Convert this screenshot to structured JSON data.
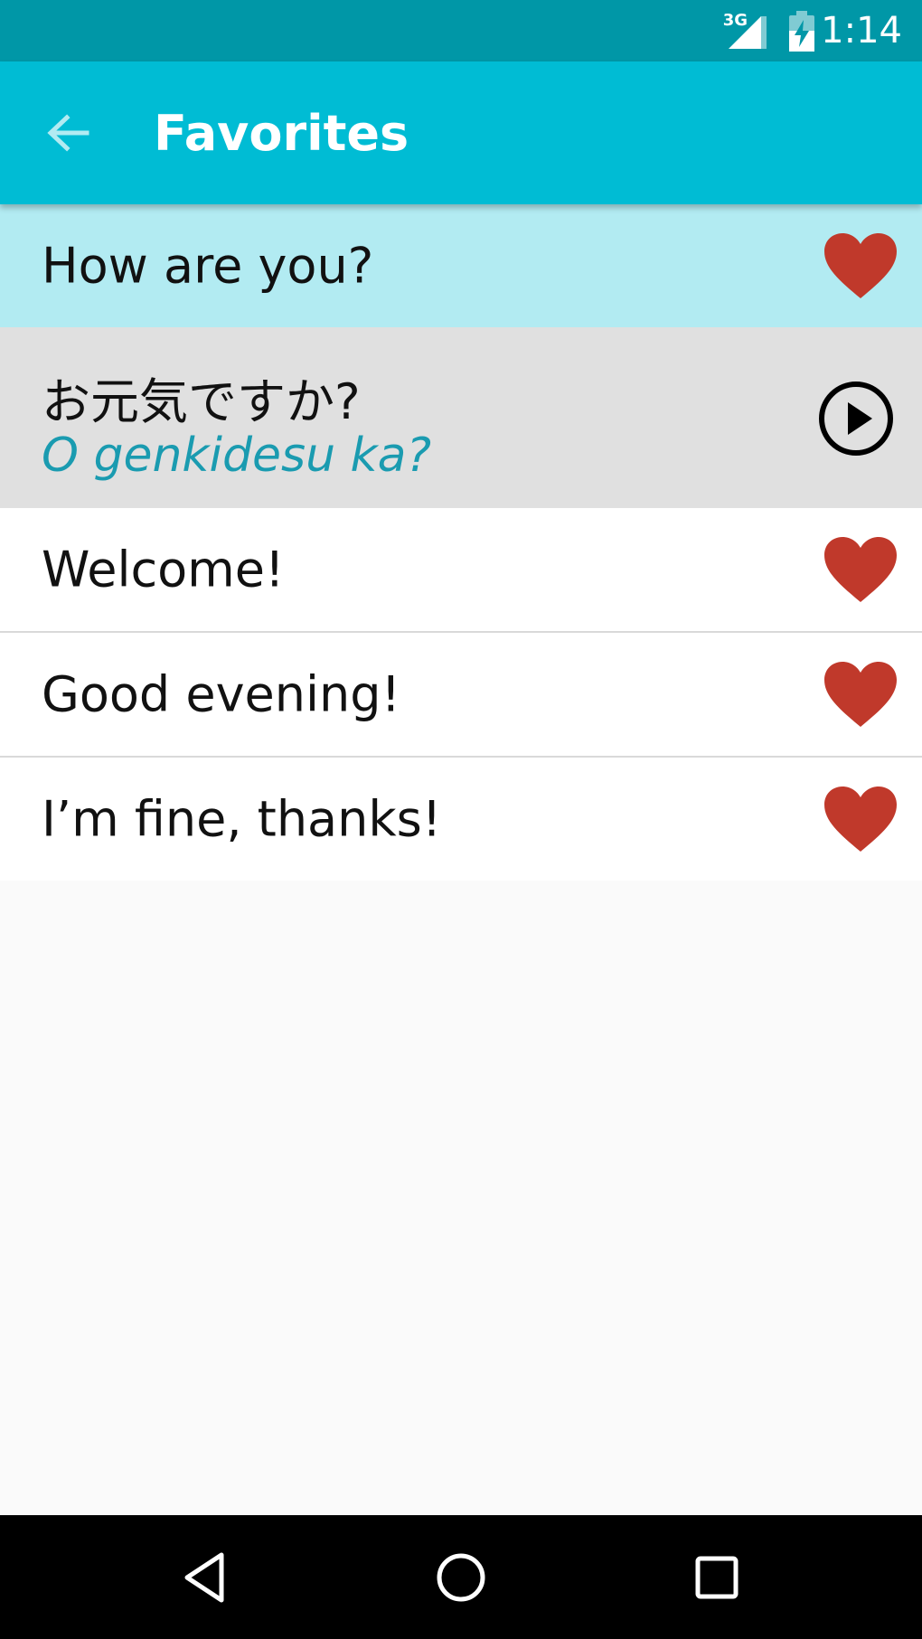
{
  "status_bar": {
    "network": "3G",
    "time": "1:14",
    "icons": [
      "signal-icon",
      "battery-charging-icon"
    ]
  },
  "app_bar": {
    "title": "Favorites",
    "back_icon": "arrow-back-icon",
    "color": "#00bcd4"
  },
  "phrases": [
    {
      "text": "How are you?",
      "selected": true,
      "favorite": true,
      "translation": {
        "native": "お元気ですか?",
        "romanized": "O genkidesu ka?",
        "action_icon": "play-circle-icon"
      }
    },
    {
      "text": "Welcome!",
      "selected": false,
      "favorite": true
    },
    {
      "text": "Good evening!",
      "selected": false,
      "favorite": true
    },
    {
      "text": "I’m fine, thanks!",
      "selected": false,
      "favorite": true
    }
  ],
  "colors": {
    "status_bar": "#0097a7",
    "selected_row": "#b2ebf2",
    "translation_bg": "#e0e0e0",
    "romanized_text": "#1a9bb0",
    "heart": "#c0392b"
  },
  "nav_bar": {
    "buttons": [
      "nav-back-icon",
      "nav-home-icon",
      "nav-recents-icon"
    ]
  }
}
